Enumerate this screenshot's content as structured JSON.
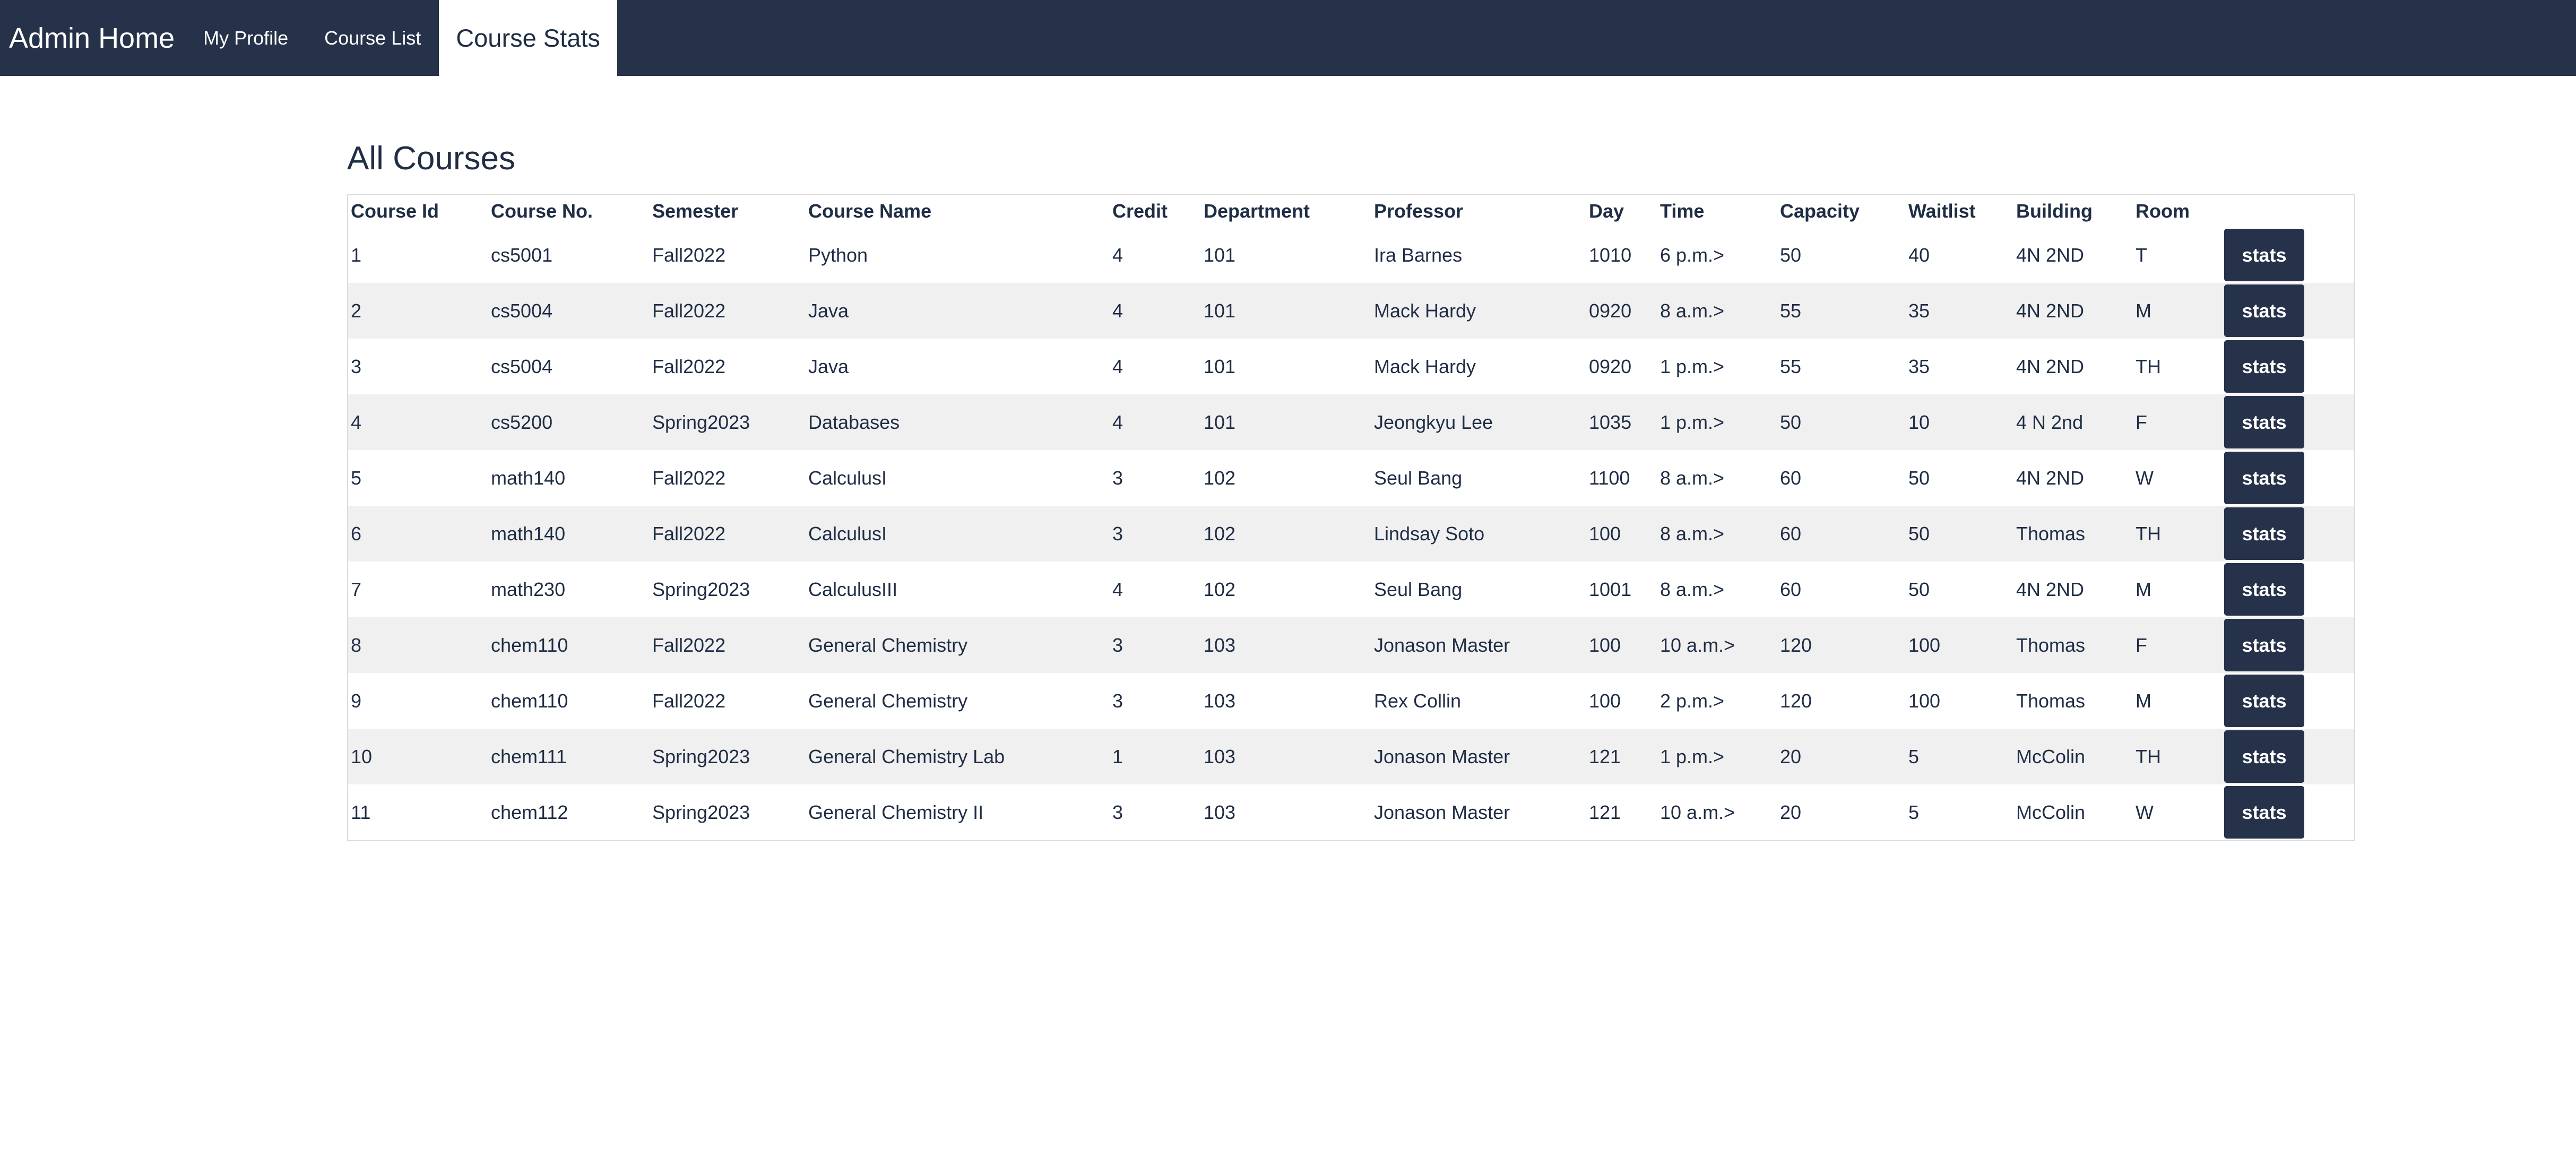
{
  "nav": {
    "brand": "Admin Home",
    "items": [
      "My Profile",
      "Course List",
      "Course Stats"
    ]
  },
  "page": {
    "title": "All Courses"
  },
  "table": {
    "headers": [
      "Course Id",
      "Course No.",
      "Semester",
      "Course Name",
      "Credit",
      "Department",
      "Professor",
      "Day",
      "Time",
      "Capacity",
      "Waitlist",
      "Building",
      "Room",
      ""
    ],
    "button_label": "stats",
    "rows": [
      [
        "1",
        "cs5001",
        "Fall2022",
        "Python",
        "4",
        "101",
        "Ira Barnes",
        "1010",
        "6 p.m.>",
        "50",
        "40",
        "4N 2ND",
        "T"
      ],
      [
        "2",
        "cs5004",
        "Fall2022",
        "Java",
        "4",
        "101",
        "Mack Hardy",
        "0920",
        "8 a.m.>",
        "55",
        "35",
        "4N 2ND",
        "M"
      ],
      [
        "3",
        "cs5004",
        "Fall2022",
        "Java",
        "4",
        "101",
        "Mack Hardy",
        "0920",
        "1 p.m.>",
        "55",
        "35",
        "4N 2ND",
        "TH"
      ],
      [
        "4",
        "cs5200",
        "Spring2023",
        "Databases",
        "4",
        "101",
        "Jeongkyu Lee",
        "1035",
        "1 p.m.>",
        "50",
        "10",
        "4 N 2nd",
        "F"
      ],
      [
        "5",
        "math140",
        "Fall2022",
        "CalculusI",
        "3",
        "102",
        "Seul Bang",
        "1100",
        "8 a.m.>",
        "60",
        "50",
        "4N 2ND",
        "W"
      ],
      [
        "6",
        "math140",
        "Fall2022",
        "CalculusI",
        "3",
        "102",
        "Lindsay Soto",
        "100",
        "8 a.m.>",
        "60",
        "50",
        "Thomas",
        "TH"
      ],
      [
        "7",
        "math230",
        "Spring2023",
        "CalculusIII",
        "4",
        "102",
        "Seul Bang",
        "1001",
        "8 a.m.>",
        "60",
        "50",
        "4N 2ND",
        "M"
      ],
      [
        "8",
        "chem110",
        "Fall2022",
        "General Chemistry",
        "3",
        "103",
        "Jonason Master",
        "100",
        "10 a.m.>",
        "120",
        "100",
        "Thomas",
        "F"
      ],
      [
        "9",
        "chem110",
        "Fall2022",
        "General Chemistry",
        "3",
        "103",
        "Rex Collin",
        "100",
        "2 p.m.>",
        "120",
        "100",
        "Thomas",
        "M"
      ],
      [
        "10",
        "chem111",
        "Spring2023",
        "General Chemistry Lab",
        "1",
        "103",
        "Jonason Master",
        "121",
        "1 p.m.>",
        "20",
        "5",
        "McColin",
        "TH"
      ],
      [
        "11",
        "chem112",
        "Spring2023",
        "General Chemistry II",
        "3",
        "103",
        "Jonason Master",
        "121",
        "10 a.m.>",
        "20",
        "5",
        "McColin",
        "W"
      ]
    ]
  }
}
